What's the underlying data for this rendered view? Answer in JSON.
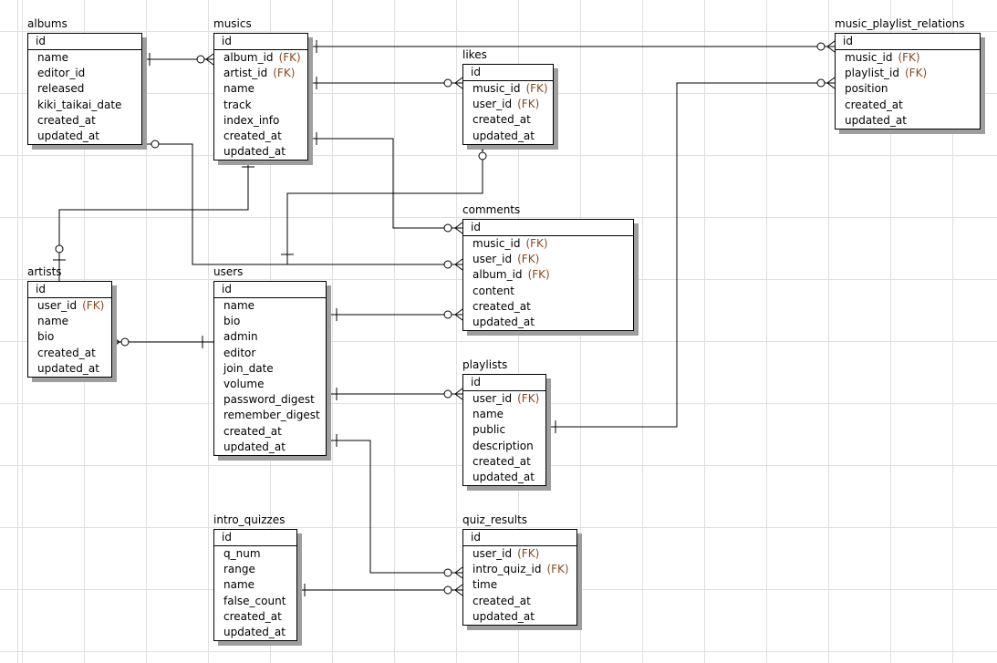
{
  "diagram": {
    "entities": [
      {
        "key": "albums",
        "name": "albums",
        "pk": "id",
        "fields": [
          {
            "name": "name",
            "fk": ""
          },
          {
            "name": "editor_id",
            "fk": ""
          },
          {
            "name": "released",
            "fk": ""
          },
          {
            "name": "kiki_taikai_date",
            "fk": ""
          },
          {
            "name": "created_at",
            "fk": ""
          },
          {
            "name": "updated_at",
            "fk": ""
          }
        ]
      },
      {
        "key": "musics",
        "name": "musics",
        "pk": "id",
        "fields": [
          {
            "name": "album_id",
            "fk": "(FK)"
          },
          {
            "name": "artist_id",
            "fk": "(FK)"
          },
          {
            "name": "name",
            "fk": ""
          },
          {
            "name": "track",
            "fk": ""
          },
          {
            "name": "index_info",
            "fk": ""
          },
          {
            "name": "created_at",
            "fk": ""
          },
          {
            "name": "updated_at",
            "fk": ""
          }
        ]
      },
      {
        "key": "likes",
        "name": "likes",
        "pk": "id",
        "fields": [
          {
            "name": "music_id",
            "fk": "(FK)"
          },
          {
            "name": "user_id",
            "fk": "(FK)"
          },
          {
            "name": "created_at",
            "fk": ""
          },
          {
            "name": "updated_at",
            "fk": ""
          }
        ]
      },
      {
        "key": "music_playlist_relations",
        "name": "music_playlist_relations",
        "pk": "id",
        "fields": [
          {
            "name": "music_id",
            "fk": "(FK)"
          },
          {
            "name": "playlist_id",
            "fk": "(FK)"
          },
          {
            "name": "position",
            "fk": ""
          },
          {
            "name": "created_at",
            "fk": ""
          },
          {
            "name": "updated_at",
            "fk": ""
          }
        ]
      },
      {
        "key": "comments",
        "name": "comments",
        "pk": "id",
        "fields": [
          {
            "name": "music_id",
            "fk": "(FK)"
          },
          {
            "name": "user_id",
            "fk": "(FK)"
          },
          {
            "name": "album_id",
            "fk": "(FK)"
          },
          {
            "name": "content",
            "fk": ""
          },
          {
            "name": "created_at",
            "fk": ""
          },
          {
            "name": "updated_at",
            "fk": ""
          }
        ]
      },
      {
        "key": "artists",
        "name": "artists",
        "pk": "id",
        "fields": [
          {
            "name": "user_id",
            "fk": "(FK)"
          },
          {
            "name": "name",
            "fk": ""
          },
          {
            "name": "bio",
            "fk": ""
          },
          {
            "name": "created_at",
            "fk": ""
          },
          {
            "name": "updated_at",
            "fk": ""
          }
        ]
      },
      {
        "key": "users",
        "name": "users",
        "pk": "id",
        "fields": [
          {
            "name": "name",
            "fk": ""
          },
          {
            "name": "bio",
            "fk": ""
          },
          {
            "name": "admin",
            "fk": ""
          },
          {
            "name": "editor",
            "fk": ""
          },
          {
            "name": "join_date",
            "fk": ""
          },
          {
            "name": "volume",
            "fk": ""
          },
          {
            "name": "password_digest",
            "fk": ""
          },
          {
            "name": "remember_digest",
            "fk": ""
          },
          {
            "name": "created_at",
            "fk": ""
          },
          {
            "name": "updated_at",
            "fk": ""
          }
        ]
      },
      {
        "key": "playlists",
        "name": "playlists",
        "pk": "id",
        "fields": [
          {
            "name": "user_id",
            "fk": "(FK)"
          },
          {
            "name": "name",
            "fk": ""
          },
          {
            "name": "public",
            "fk": ""
          },
          {
            "name": "description",
            "fk": ""
          },
          {
            "name": "created_at",
            "fk": ""
          },
          {
            "name": "updated_at",
            "fk": ""
          }
        ]
      },
      {
        "key": "intro_quizzes",
        "name": "intro_quizzes",
        "pk": "id",
        "fields": [
          {
            "name": "q_num",
            "fk": ""
          },
          {
            "name": "range",
            "fk": ""
          },
          {
            "name": "name",
            "fk": ""
          },
          {
            "name": "false_count",
            "fk": ""
          },
          {
            "name": "created_at",
            "fk": ""
          },
          {
            "name": "updated_at",
            "fk": ""
          }
        ]
      },
      {
        "key": "quiz_results",
        "name": "quiz_results",
        "pk": "id",
        "fields": [
          {
            "name": "user_id",
            "fk": "(FK)"
          },
          {
            "name": "intro_quiz_id",
            "fk": "(FK)"
          },
          {
            "name": "time",
            "fk": ""
          },
          {
            "name": "created_at",
            "fk": ""
          },
          {
            "name": "updated_at",
            "fk": ""
          }
        ]
      }
    ],
    "relationships": [
      {
        "from": "albums",
        "to": "musics",
        "from_end": "one-or-zero",
        "to_end": "zero-or-many"
      },
      {
        "from": "musics",
        "to": "music_playlist_relations",
        "from_end": "one",
        "to_end": "zero-or-many"
      },
      {
        "from": "musics",
        "to": "likes",
        "from_end": "one",
        "to_end": "zero-or-many"
      },
      {
        "from": "musics",
        "to": "comments",
        "from_end": "one",
        "to_end": "zero-or-many"
      },
      {
        "from": "albums",
        "to": "comments",
        "from_end": "zero-or-one",
        "to_end": "zero-or-many"
      },
      {
        "from": "users",
        "to": "likes",
        "from_end": "one",
        "to_end": "zero-or-many"
      },
      {
        "from": "artists",
        "to": "musics",
        "from_end": "zero-or-one",
        "to_end": "one"
      },
      {
        "from": "users",
        "to": "artists",
        "from_end": "one",
        "to_end": "zero-or-many"
      },
      {
        "from": "users",
        "to": "comments",
        "from_end": "one",
        "to_end": "zero-or-many"
      },
      {
        "from": "users",
        "to": "playlists",
        "from_end": "one",
        "to_end": "zero-or-many"
      },
      {
        "from": "playlists",
        "to": "music_playlist_relations",
        "from_end": "one",
        "to_end": "zero-or-many"
      },
      {
        "from": "users",
        "to": "quiz_results",
        "from_end": "one",
        "to_end": "zero-or-many"
      },
      {
        "from": "intro_quizzes",
        "to": "quiz_results",
        "from_end": "one",
        "to_end": "zero-or-many"
      }
    ]
  }
}
